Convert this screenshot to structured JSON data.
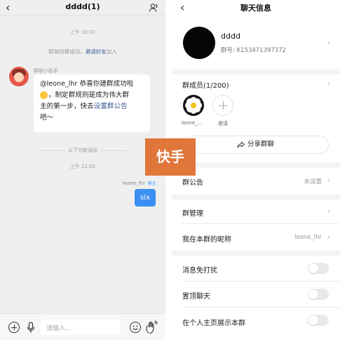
{
  "chat": {
    "title": "dddd(1)",
    "timestamp_1": "上午 10:37",
    "system_created": "群聊创建成功，",
    "system_invite_link": "邀请好友",
    "system_join": "加入",
    "assistant_name": "群聊小助手",
    "assistant_msg_1": "@leone_lhr 恭喜你建群成功啦",
    "assistant_msg_2": "，制定群规则是成为伟大群",
    "assistant_msg_3": "主的第一步，快去",
    "assistant_msg_link": "设置群公告",
    "assistant_msg_4": "吧～",
    "unread_divider": "以下为新消息",
    "timestamp_2": "上午 11:02",
    "my_name": "leone_lhr",
    "my_badge": "群主",
    "my_message": "six",
    "input_placeholder": "请输入..."
  },
  "watermark": {
    "text": "快手"
  },
  "info": {
    "title": "聊天信息",
    "group_name": "dddd",
    "group_id": "群号: K153471397372",
    "members_label": "群成员(1/200)",
    "member_name": "leone_...",
    "invite_label": "邀请",
    "share_label": "分享群聊",
    "announcement_label": "群公告",
    "announcement_value": "未设置",
    "manage_label": "群管理",
    "nickname_label": "我在本群的昵称",
    "nickname_value": "leone_lhr",
    "mute_label": "消息免打扰",
    "pin_label": "置顶聊天",
    "show_profile_label": "在个人主页展示本群"
  },
  "colors": {
    "link": "#3d5a98",
    "my_bubble": "#3b8ff2",
    "watermark": "#e0763a",
    "toggle_off": "#e9e9e9"
  }
}
